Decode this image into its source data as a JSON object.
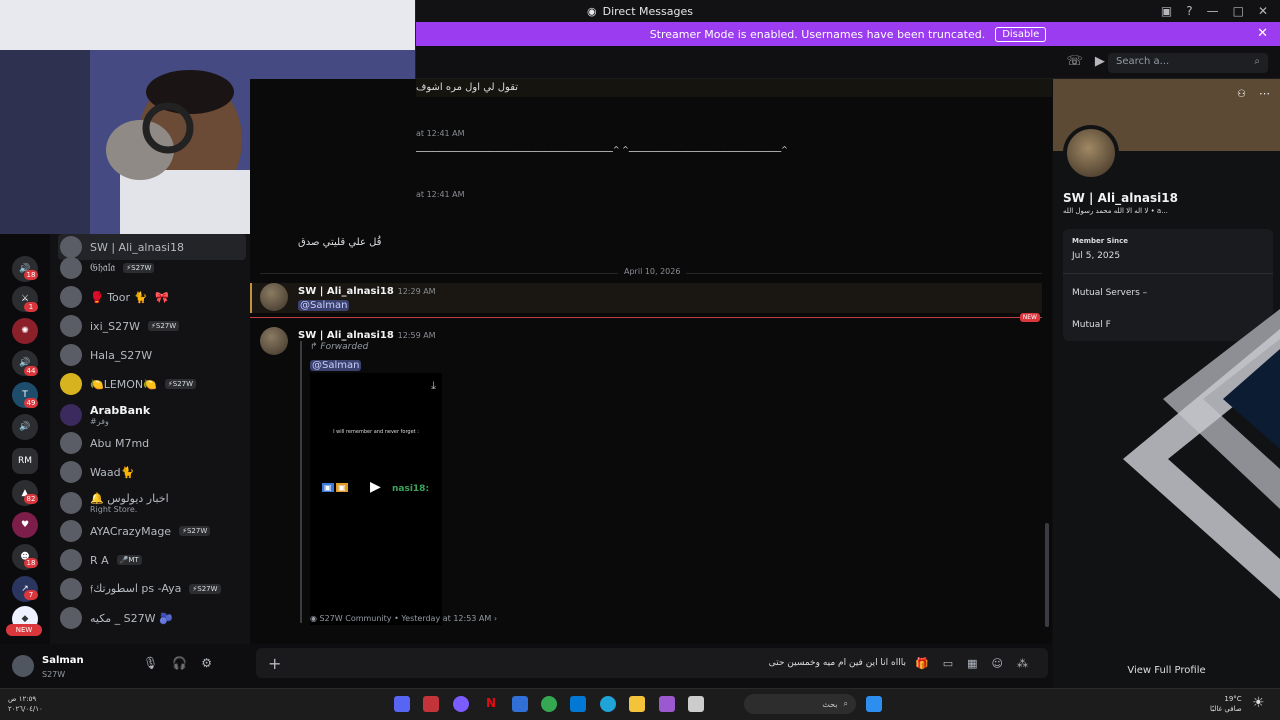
{
  "window": {
    "title": "Direct Messages",
    "controls": [
      "—",
      "□",
      "✕"
    ]
  },
  "banner": {
    "text": "Streamer Mode is enabled. Usernames have been truncated.",
    "button": "Disable"
  },
  "header": {
    "search_placeholder": "Search a..."
  },
  "guilds": {
    "badges": [
      "18",
      "1",
      "44",
      "49",
      "82",
      "18",
      "7"
    ],
    "rm_label": "RM",
    "new_label": "NEW"
  },
  "dm_list": [
    {
      "name": "SW | Ali_alnasi18",
      "tag": ""
    },
    {
      "name": "𝔊𝔥𝔞𝔩𝔞",
      "tag": "⚡S27W"
    },
    {
      "name": "🥊 Toor 🐈",
      "tag": "🎀"
    },
    {
      "name": "ixi_S27W",
      "tag": "⚡S27W"
    },
    {
      "name": "Hala_S27W",
      "tag": ""
    },
    {
      "name": "🍋LEMON🍋",
      "tag": "⚡S27W"
    },
    {
      "name": "ArabBank",
      "tag": "",
      "sub": "#وفر"
    },
    {
      "name": "Abu M7md",
      "tag": ""
    },
    {
      "name": "Waad🐈",
      "tag": ""
    },
    {
      "name": "🔔 اخبار ديولوس",
      "tag": "",
      "sub": "Right Store."
    },
    {
      "name": "AYACrazyMage",
      "tag": "⚡S27W"
    },
    {
      "name": "R A",
      "tag": "🎤MT"
    },
    {
      "name": "𝔣اسطورتك ps -Aya",
      "tag": "⚡S27W"
    },
    {
      "name": "مكيه _ S27W 🫐",
      "tag": ""
    }
  ],
  "user_panel": {
    "name": "Salman",
    "status": "S27W"
  },
  "chat": {
    "top_line": "تقول لي اول مره اشوف",
    "ts1": "at 12:41 AM",
    "long_text": "ـــــــــــــــــــــــــــــــــــــــــــــــــــــــــــــــــ^ ^ــــــــــــــــــــــــــــــــــــــــــــــــــــــــــــــــــــــــــــــــــــ^",
    "ts2": "at 12:41 AM",
    "arabic_msg": "قُل علي قليتي صدق",
    "date_divider": "April 10, 2026",
    "msg1": {
      "author": "SW | Ali_alnasi18",
      "time": "12:29 AM",
      "mention": "@Salman"
    },
    "msg2": {
      "author": "SW | Ali_alnasi18",
      "time": "12:59 AM",
      "forwarded": "Forwarded",
      "mention": "@Salman",
      "media_caption": "I will remember and never forget :",
      "media_name": "nasi18:",
      "source": "S27W Community",
      "source_time": "Yesterday at 12:53 AM"
    },
    "new_badge": "NEW"
  },
  "composer": {
    "placeholder": "باااه انا اين فين ام ميه وخمسين حتى"
  },
  "profile": {
    "name": "SW | Ali_alnasi18",
    "bio": "لا اله الا الله محمد رسول الله • a...",
    "member_since_label": "Member Since",
    "member_since": "Jul 5, 2025",
    "mutual_servers": "Mutual Servers –",
    "mutual_friends": "Mutual F",
    "view_full": "View Full Profile"
  },
  "taskbar": {
    "search_text": "بحث",
    "weather_temp": "19°C",
    "weather_desc": "صافي غالبًا",
    "clock_time": "١٢:٥٩ ص",
    "clock_date": "٢٠٢٦/٠٤/١٠"
  },
  "colors": {
    "banner": "#9b3cf0",
    "accent": "#5865f2",
    "new": "#da373c",
    "highlight_border": "#c7923d"
  }
}
